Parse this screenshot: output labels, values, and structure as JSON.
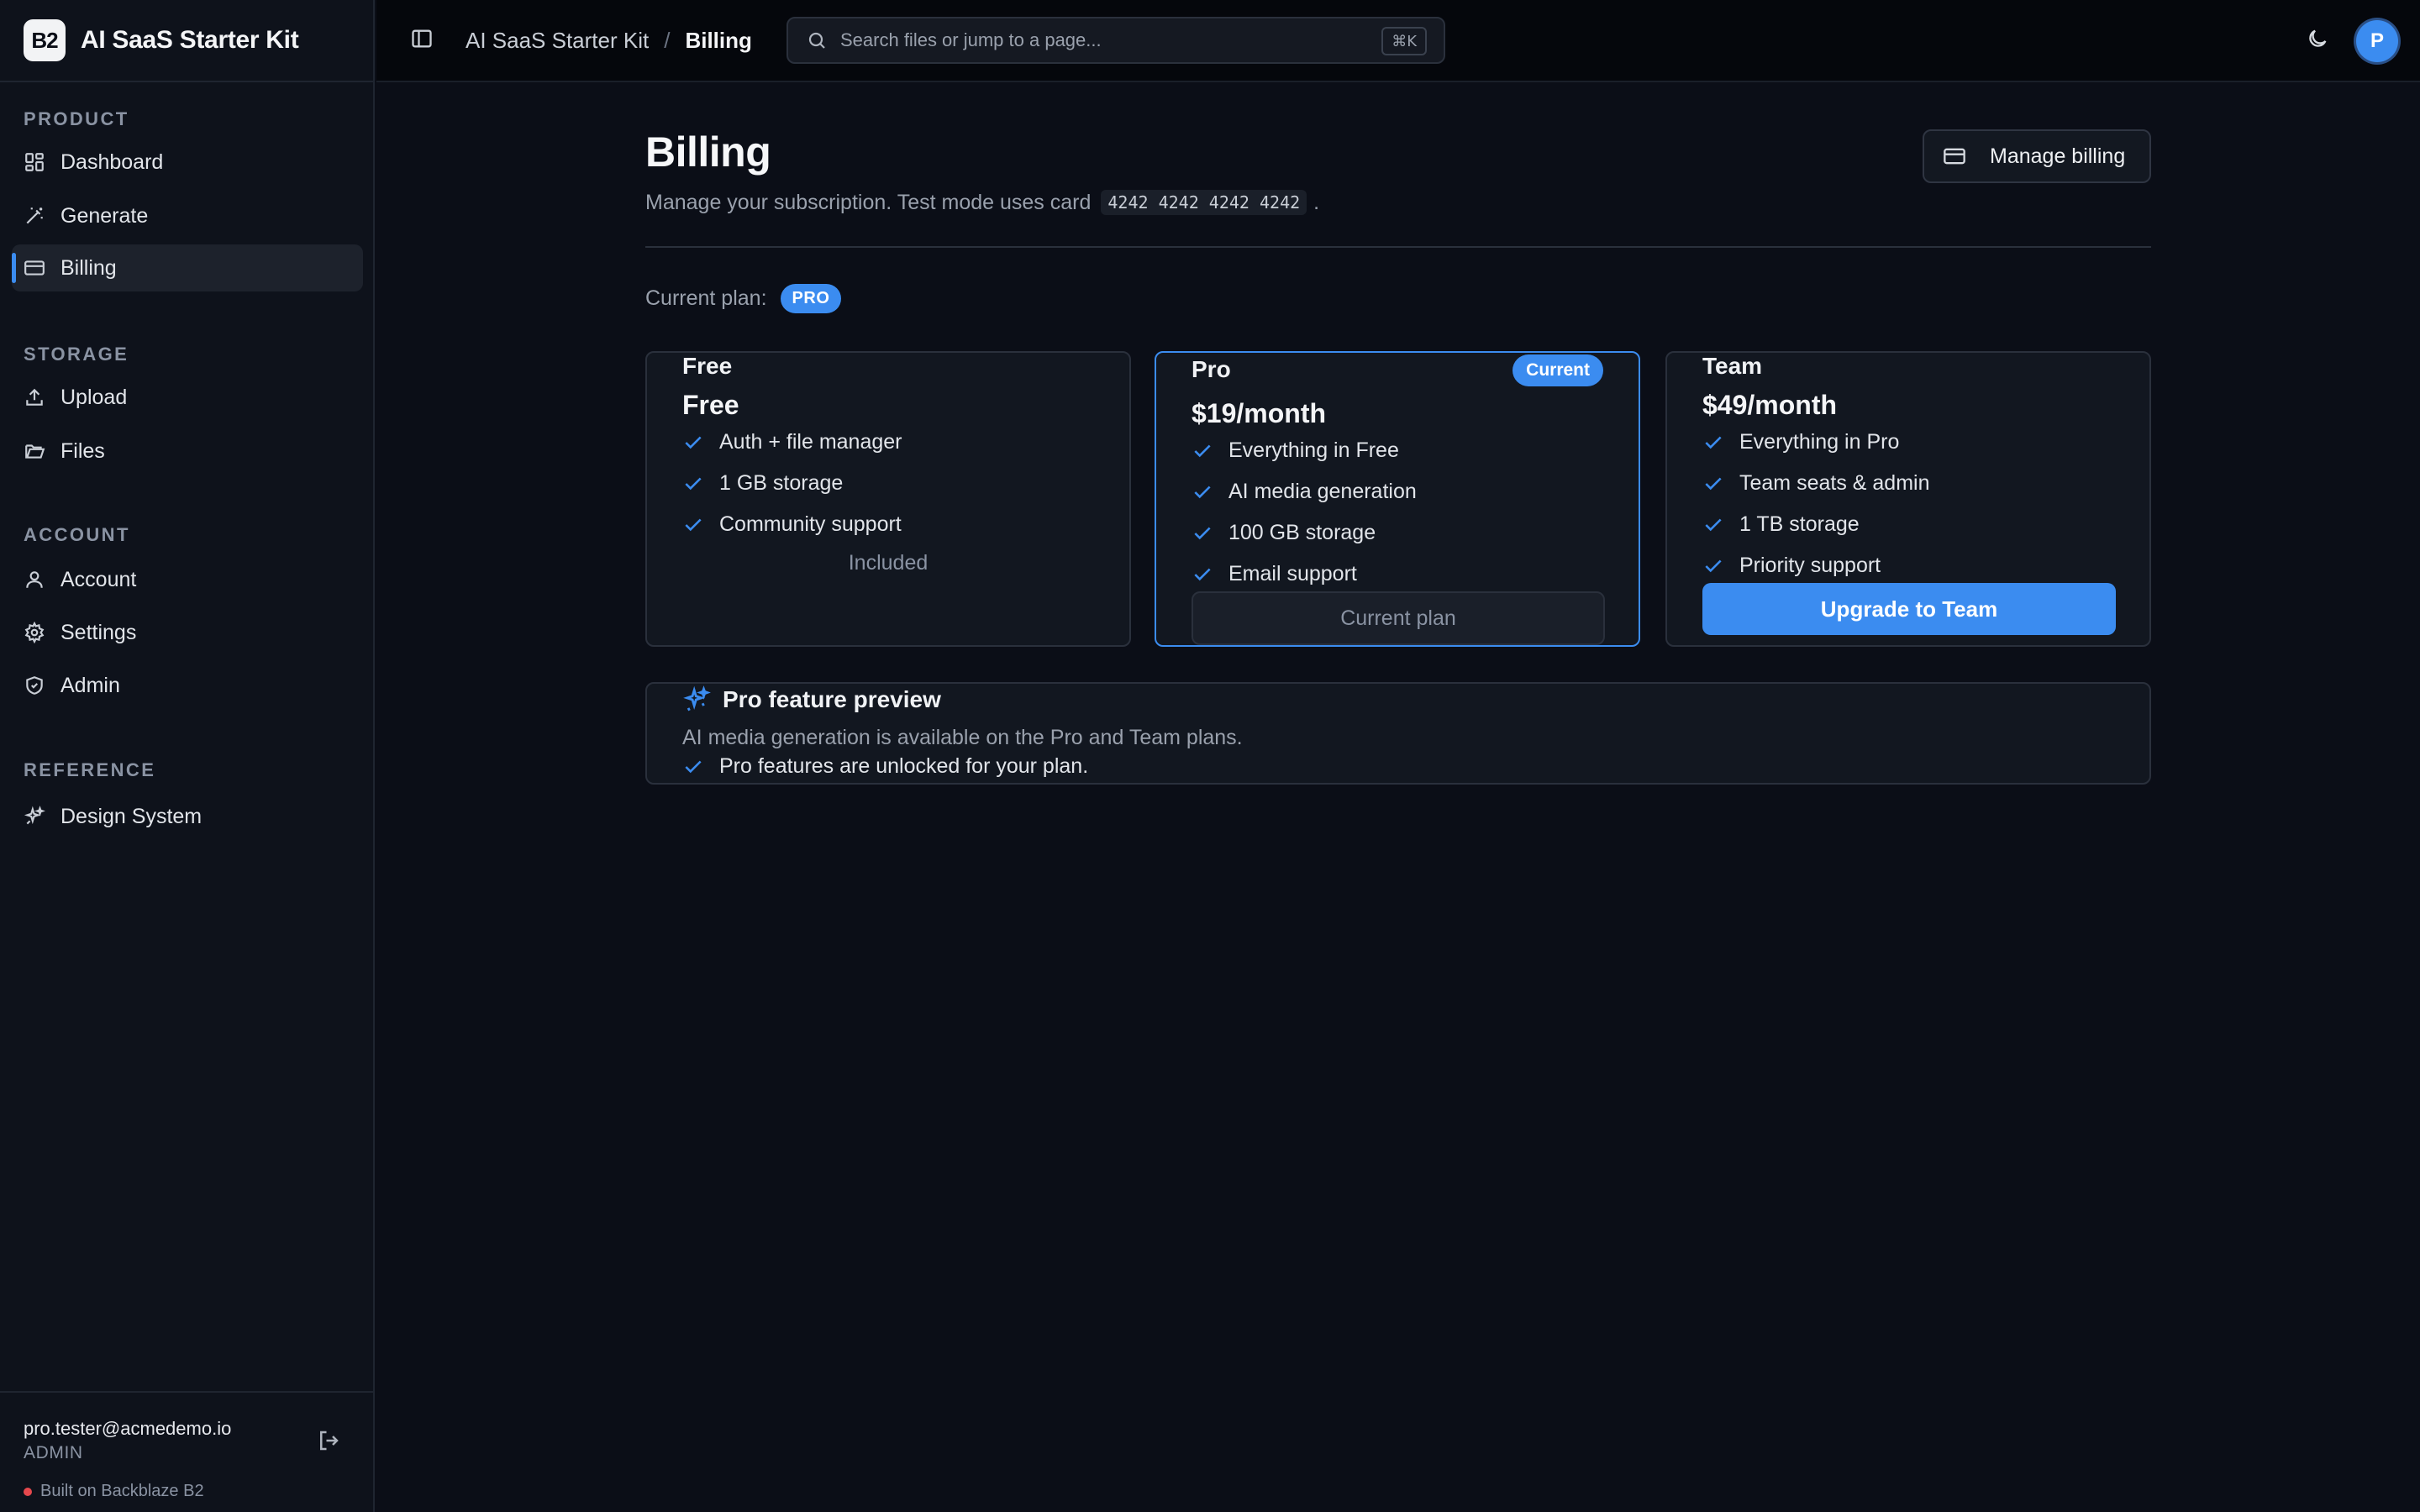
{
  "brand": {
    "logo": "B2",
    "name": "AI SaaS Starter Kit"
  },
  "sidebar": {
    "sections": [
      {
        "label": "PRODUCT",
        "items": [
          {
            "label": "Dashboard",
            "icon": "dashboard-icon"
          },
          {
            "label": "Generate",
            "icon": "wand-icon"
          },
          {
            "label": "Billing",
            "icon": "credit-card-icon",
            "active": true
          }
        ]
      },
      {
        "label": "STORAGE",
        "items": [
          {
            "label": "Upload",
            "icon": "upload-icon"
          },
          {
            "label": "Files",
            "icon": "folder-icon"
          }
        ]
      },
      {
        "label": "ACCOUNT",
        "items": [
          {
            "label": "Account",
            "icon": "user-icon"
          },
          {
            "label": "Settings",
            "icon": "gear-icon"
          },
          {
            "label": "Admin",
            "icon": "shield-icon"
          }
        ]
      },
      {
        "label": "REFERENCE",
        "items": [
          {
            "label": "Design System",
            "icon": "sparkles-icon"
          }
        ]
      }
    ],
    "footer": {
      "email": "pro.tester@acmedemo.io",
      "role": "ADMIN",
      "built_on": "Built on Backblaze B2"
    }
  },
  "topbar": {
    "breadcrumb_root": "AI SaaS Starter Kit",
    "breadcrumb_sep": "/",
    "breadcrumb_current": "Billing",
    "search_placeholder": "Search files or jump to a page...",
    "search_shortcut": "⌘K",
    "avatar_initial": "P"
  },
  "main": {
    "title": "Billing",
    "subtitle": "Manage your subscription. Test mode uses card",
    "test_card": "4242 4242 4242 4242",
    "subtitle_end": ".",
    "manage_billing_label": "Manage billing",
    "current_plan_label": "Current plan:",
    "current_plan_badge": "PRO",
    "plans": [
      {
        "name": "Free",
        "price": "Free",
        "features": [
          "Auth + file manager",
          "1 GB storage",
          "Community support"
        ],
        "footer_text": "Included"
      },
      {
        "name": "Pro",
        "price": "$19/month",
        "tag": "Current",
        "features": [
          "Everything in Free",
          "AI media generation",
          "100 GB storage",
          "Email support"
        ],
        "button_label": "Current plan"
      },
      {
        "name": "Team",
        "price": "$49/month",
        "features": [
          "Everything in Pro",
          "Team seats & admin",
          "1 TB storage",
          "Priority support"
        ],
        "button_label": "Upgrade to Team"
      }
    ],
    "preview": {
      "title": "Pro feature preview",
      "description": "AI media generation is available on the Pro and Team plans.",
      "status": "Pro features are unlocked for your plan."
    }
  },
  "colors": {
    "accent": "#3b8cf0",
    "background": "#0b0e17",
    "danger_dot": "#e5484d"
  }
}
